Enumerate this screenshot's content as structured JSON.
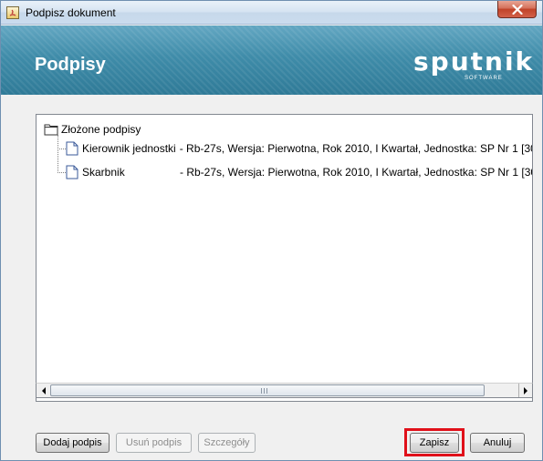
{
  "window": {
    "title": "Podpisz dokument"
  },
  "banner": {
    "title": "Podpisy",
    "logo": "sputnik",
    "logo_sub": "SOFTWARE"
  },
  "tree": {
    "root_label": "Złożone podpisy",
    "items": [
      {
        "signer": "Kierownik jednostki",
        "details": "- Rb-27s, Wersja: Pierwotna, Rok 2010, I Kwartał, Jednostka: SP Nr 1 [30"
      },
      {
        "signer": "Skarbnik",
        "details": "- Rb-27s, Wersja: Pierwotna, Rok 2010, I Kwartał, Jednostka: SP Nr 1 [30"
      }
    ]
  },
  "buttons": {
    "add_signature": "Dodaj podpis",
    "remove_signature": "Usuń podpis",
    "details": "Szczegóły",
    "save": "Zapisz",
    "cancel": "Anuluj"
  },
  "colors": {
    "banner": "#3f8ca9",
    "highlight": "#e0101a"
  }
}
